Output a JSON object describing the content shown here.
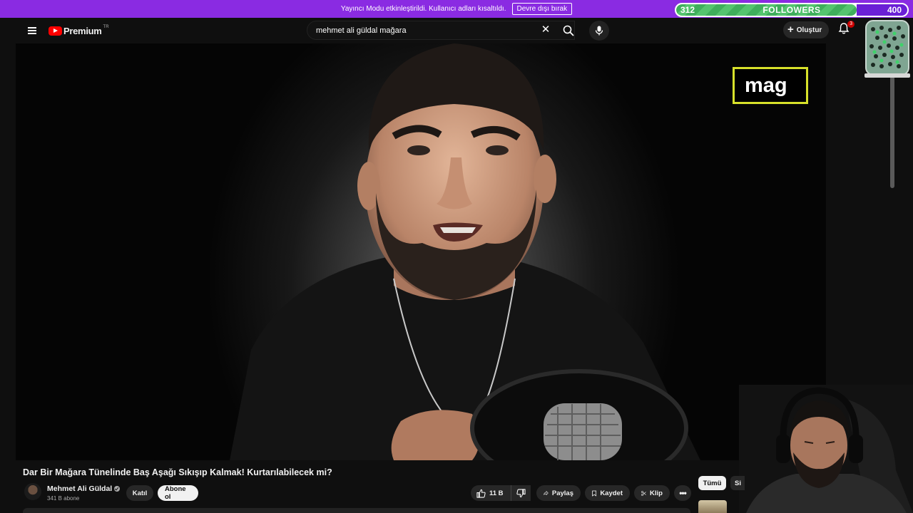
{
  "streamer_banner": {
    "message": "Yayıncı Modu etkinleştirildi. Kullanıcı adları kısaltıldı.",
    "disable_label": "Devre dışı bırak"
  },
  "followers_widget": {
    "current": "312",
    "label": "FOLLOWERS",
    "goal": "400",
    "progress": 0.78,
    "fill_color": "#4cbb66",
    "rest_color": "#6a1fd6"
  },
  "header": {
    "logo_text": "Premium",
    "logo_region": "TR",
    "search_value": "mehmet ali güldal mağara",
    "create_label": "Oluştur",
    "notification_count": "3"
  },
  "video": {
    "overlay_text": "mag",
    "overlay_border_color": "#d7e12a",
    "title": "Dar Bir Mağara Tünelinde Baş Aşağı Sıkışıp Kalmak! Kurtarılabilecek mi?"
  },
  "channel": {
    "name": "Mehmet Ali Güldal",
    "subscribers": "341 B abone",
    "join_label": "Katıl",
    "subscribe_label": "Abone ol"
  },
  "actions": {
    "likes": "11 B",
    "share_label": "Paylaş",
    "save_label": "Kaydet",
    "clip_label": "Klip"
  },
  "chips": {
    "all_label": "Tümü",
    "next_label": "Si"
  },
  "colors": {
    "background": "#0f0f0f",
    "banner": "#8a2be2",
    "brand_red": "#ff0000"
  }
}
